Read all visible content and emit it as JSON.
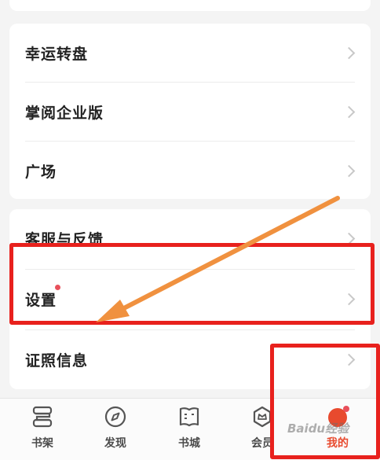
{
  "menu_group_1": [
    {
      "label": "幸运转盘"
    },
    {
      "label": "掌阅企业版"
    },
    {
      "label": "广场"
    }
  ],
  "menu_group_2": [
    {
      "label": "客服与反馈"
    },
    {
      "label": "设置",
      "has_badge": true
    },
    {
      "label": "证照信息"
    }
  ],
  "tabbar": {
    "tabs": [
      {
        "label": "书架",
        "icon": "bookshelf-icon"
      },
      {
        "label": "发现",
        "icon": "compass-icon"
      },
      {
        "label": "书城",
        "icon": "book-store-icon"
      },
      {
        "label": "会员",
        "icon": "vip-crown-icon"
      },
      {
        "label": "我的",
        "icon": "profile-icon",
        "active": true
      }
    ]
  },
  "watermark": "Baidu经验",
  "colors": {
    "accent": "#e84a2e",
    "highlight_box": "#e8211d",
    "arrow": "#f0913f",
    "badge": "#e8505b"
  }
}
